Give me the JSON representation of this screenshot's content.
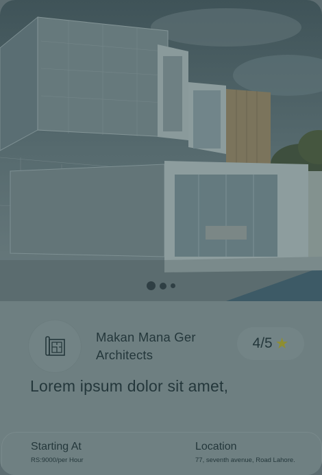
{
  "carousel": {
    "pages": 3,
    "active": 1
  },
  "company": {
    "name": "Makan Mana Ger Architects",
    "logo_icon": "blueprint-icon"
  },
  "rating": {
    "value": "4/5",
    "icon": "star-icon"
  },
  "description": "Lorem ipsum dolor sit amet,",
  "details": {
    "price_label": "Starting At",
    "price_value": "RS:9000/per Hour",
    "location_label": "Location",
    "location_value": "77, seventh avenue, Road Lahore."
  },
  "colors": {
    "text": "#24373b",
    "star": "#8f8e30",
    "overlay": "#6e7e80"
  }
}
